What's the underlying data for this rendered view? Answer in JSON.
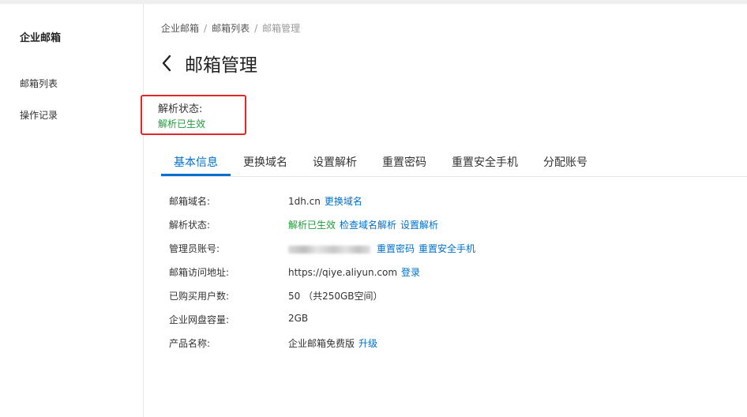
{
  "sidebar": {
    "title": "企业邮箱",
    "items": [
      {
        "label": "邮箱列表"
      },
      {
        "label": "操作记录"
      }
    ]
  },
  "breadcrumb": {
    "items": [
      "企业邮箱",
      "邮箱列表",
      "邮箱管理"
    ],
    "separator": "/"
  },
  "page": {
    "title": "邮箱管理"
  },
  "status_box": {
    "label": "解析状态:",
    "value": "解析已生效",
    "highlight_color": "#e0282b"
  },
  "tabs": [
    {
      "label": "基本信息",
      "active": true
    },
    {
      "label": "更换域名"
    },
    {
      "label": "设置解析"
    },
    {
      "label": "重置密码"
    },
    {
      "label": "重置安全手机"
    },
    {
      "label": "分配账号"
    }
  ],
  "info": {
    "domain": {
      "label": "邮箱域名:",
      "value": "1dh.cn",
      "action": "更换域名"
    },
    "resolve": {
      "label": "解析状态:",
      "value": "解析已生效",
      "action1": "检查域名解析",
      "action2": "设置解析"
    },
    "admin": {
      "label": "管理员账号:",
      "value_redacted": true,
      "action1": "重置密码",
      "action2": "重置安全手机"
    },
    "access": {
      "label": "邮箱访问地址:",
      "value": "https://qiye.aliyun.com",
      "action": "登录"
    },
    "users": {
      "label": "已购买用户数:",
      "value": "50 （共250GB空间）"
    },
    "disk": {
      "label": "企业网盘容量:",
      "value": "2GB"
    },
    "product": {
      "label": "产品名称:",
      "value": "企业邮箱免费版",
      "action": "升级"
    }
  },
  "colors": {
    "link": "#0070cc",
    "success": "#1f9c3a",
    "accent": "#0070cc"
  },
  "icons": {
    "back": "chevron-left-icon"
  }
}
